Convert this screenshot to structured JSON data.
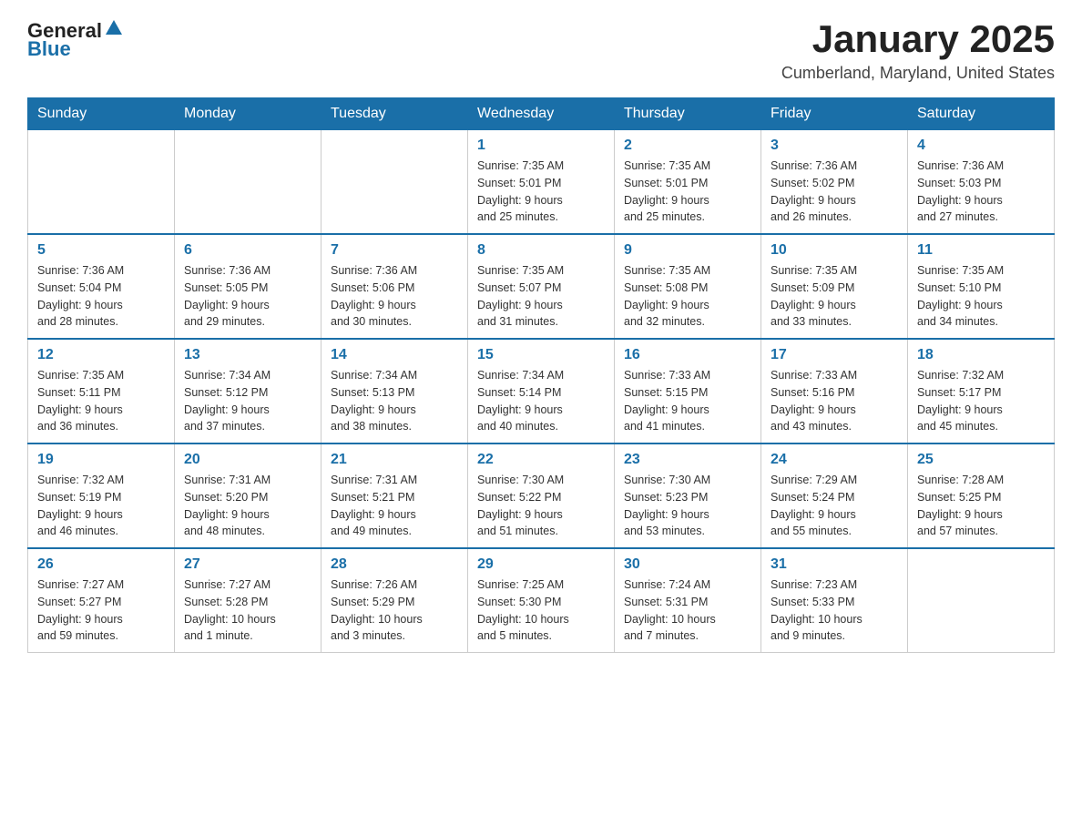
{
  "header": {
    "logo_general": "General",
    "logo_blue": "Blue",
    "month_title": "January 2025",
    "location": "Cumberland, Maryland, United States"
  },
  "days_of_week": [
    "Sunday",
    "Monday",
    "Tuesday",
    "Wednesday",
    "Thursday",
    "Friday",
    "Saturday"
  ],
  "weeks": [
    [
      {
        "day": "",
        "info": ""
      },
      {
        "day": "",
        "info": ""
      },
      {
        "day": "",
        "info": ""
      },
      {
        "day": "1",
        "info": "Sunrise: 7:35 AM\nSunset: 5:01 PM\nDaylight: 9 hours\nand 25 minutes."
      },
      {
        "day": "2",
        "info": "Sunrise: 7:35 AM\nSunset: 5:01 PM\nDaylight: 9 hours\nand 25 minutes."
      },
      {
        "day": "3",
        "info": "Sunrise: 7:36 AM\nSunset: 5:02 PM\nDaylight: 9 hours\nand 26 minutes."
      },
      {
        "day": "4",
        "info": "Sunrise: 7:36 AM\nSunset: 5:03 PM\nDaylight: 9 hours\nand 27 minutes."
      }
    ],
    [
      {
        "day": "5",
        "info": "Sunrise: 7:36 AM\nSunset: 5:04 PM\nDaylight: 9 hours\nand 28 minutes."
      },
      {
        "day": "6",
        "info": "Sunrise: 7:36 AM\nSunset: 5:05 PM\nDaylight: 9 hours\nand 29 minutes."
      },
      {
        "day": "7",
        "info": "Sunrise: 7:36 AM\nSunset: 5:06 PM\nDaylight: 9 hours\nand 30 minutes."
      },
      {
        "day": "8",
        "info": "Sunrise: 7:35 AM\nSunset: 5:07 PM\nDaylight: 9 hours\nand 31 minutes."
      },
      {
        "day": "9",
        "info": "Sunrise: 7:35 AM\nSunset: 5:08 PM\nDaylight: 9 hours\nand 32 minutes."
      },
      {
        "day": "10",
        "info": "Sunrise: 7:35 AM\nSunset: 5:09 PM\nDaylight: 9 hours\nand 33 minutes."
      },
      {
        "day": "11",
        "info": "Sunrise: 7:35 AM\nSunset: 5:10 PM\nDaylight: 9 hours\nand 34 minutes."
      }
    ],
    [
      {
        "day": "12",
        "info": "Sunrise: 7:35 AM\nSunset: 5:11 PM\nDaylight: 9 hours\nand 36 minutes."
      },
      {
        "day": "13",
        "info": "Sunrise: 7:34 AM\nSunset: 5:12 PM\nDaylight: 9 hours\nand 37 minutes."
      },
      {
        "day": "14",
        "info": "Sunrise: 7:34 AM\nSunset: 5:13 PM\nDaylight: 9 hours\nand 38 minutes."
      },
      {
        "day": "15",
        "info": "Sunrise: 7:34 AM\nSunset: 5:14 PM\nDaylight: 9 hours\nand 40 minutes."
      },
      {
        "day": "16",
        "info": "Sunrise: 7:33 AM\nSunset: 5:15 PM\nDaylight: 9 hours\nand 41 minutes."
      },
      {
        "day": "17",
        "info": "Sunrise: 7:33 AM\nSunset: 5:16 PM\nDaylight: 9 hours\nand 43 minutes."
      },
      {
        "day": "18",
        "info": "Sunrise: 7:32 AM\nSunset: 5:17 PM\nDaylight: 9 hours\nand 45 minutes."
      }
    ],
    [
      {
        "day": "19",
        "info": "Sunrise: 7:32 AM\nSunset: 5:19 PM\nDaylight: 9 hours\nand 46 minutes."
      },
      {
        "day": "20",
        "info": "Sunrise: 7:31 AM\nSunset: 5:20 PM\nDaylight: 9 hours\nand 48 minutes."
      },
      {
        "day": "21",
        "info": "Sunrise: 7:31 AM\nSunset: 5:21 PM\nDaylight: 9 hours\nand 49 minutes."
      },
      {
        "day": "22",
        "info": "Sunrise: 7:30 AM\nSunset: 5:22 PM\nDaylight: 9 hours\nand 51 minutes."
      },
      {
        "day": "23",
        "info": "Sunrise: 7:30 AM\nSunset: 5:23 PM\nDaylight: 9 hours\nand 53 minutes."
      },
      {
        "day": "24",
        "info": "Sunrise: 7:29 AM\nSunset: 5:24 PM\nDaylight: 9 hours\nand 55 minutes."
      },
      {
        "day": "25",
        "info": "Sunrise: 7:28 AM\nSunset: 5:25 PM\nDaylight: 9 hours\nand 57 minutes."
      }
    ],
    [
      {
        "day": "26",
        "info": "Sunrise: 7:27 AM\nSunset: 5:27 PM\nDaylight: 9 hours\nand 59 minutes."
      },
      {
        "day": "27",
        "info": "Sunrise: 7:27 AM\nSunset: 5:28 PM\nDaylight: 10 hours\nand 1 minute."
      },
      {
        "day": "28",
        "info": "Sunrise: 7:26 AM\nSunset: 5:29 PM\nDaylight: 10 hours\nand 3 minutes."
      },
      {
        "day": "29",
        "info": "Sunrise: 7:25 AM\nSunset: 5:30 PM\nDaylight: 10 hours\nand 5 minutes."
      },
      {
        "day": "30",
        "info": "Sunrise: 7:24 AM\nSunset: 5:31 PM\nDaylight: 10 hours\nand 7 minutes."
      },
      {
        "day": "31",
        "info": "Sunrise: 7:23 AM\nSunset: 5:33 PM\nDaylight: 10 hours\nand 9 minutes."
      },
      {
        "day": "",
        "info": ""
      }
    ]
  ]
}
